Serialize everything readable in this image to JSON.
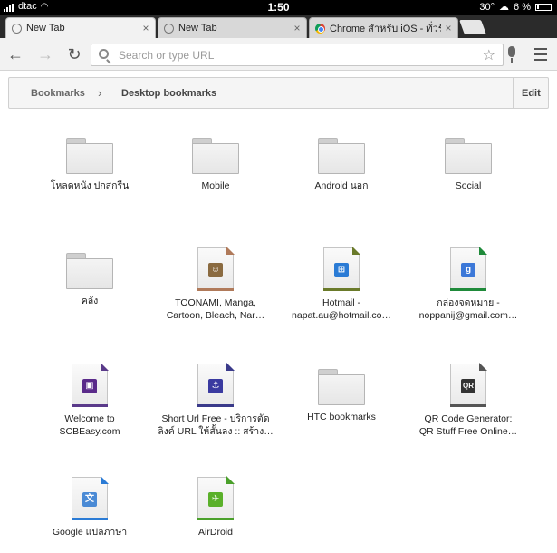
{
  "status": {
    "carrier": "dtac",
    "time": "1:50",
    "weather": "30°",
    "battery": "6 %"
  },
  "tabs": [
    {
      "title": "New Tab",
      "close": "×"
    },
    {
      "title": "New Tab",
      "close": "×"
    },
    {
      "title": "Chrome สำหรับ iOS - ทั่วร้อนแน่",
      "close": "×"
    }
  ],
  "toolbar": {
    "back": "←",
    "forward": "→",
    "reload": "↻",
    "search_placeholder": "Search or type URL",
    "star": "☆"
  },
  "breadcrumb": {
    "root": "Bookmarks",
    "separator": "›",
    "current": "Desktop bookmarks",
    "edit": "Edit"
  },
  "items": [
    {
      "kind": "folder",
      "label": "โหลดหนัง ปกสกรีน"
    },
    {
      "kind": "folder",
      "label": "Mobile"
    },
    {
      "kind": "folder",
      "label": "Android นอก"
    },
    {
      "kind": "folder",
      "label": "Social"
    },
    {
      "kind": "folder",
      "label": "คลัง"
    },
    {
      "kind": "page",
      "label": "TOONAMI, Manga,\nCartoon, Bleach, Nar…",
      "stripe": "#b07a5a",
      "favicon": "☺",
      "favcolor": "#8a6a40"
    },
    {
      "kind": "page",
      "label": "Hotmail -\nnapat.au@hotmail.co…",
      "stripe": "#6a7a2a",
      "favicon": "⊞",
      "favcolor": "#2a7bd5"
    },
    {
      "kind": "page",
      "label": "กล่องจดหมาย -\nnoppanij@gmail.com…",
      "stripe": "#1f8a3a",
      "favicon": "g",
      "favcolor": "#3c78d8"
    },
    {
      "kind": "page",
      "label": "Welcome to\nSCBEasy.com",
      "stripe": "#5a3a8a",
      "favicon": "▣",
      "favcolor": "#5a2a8a"
    },
    {
      "kind": "page",
      "label": "Short Url Free - บริการตัด\nลิงค์ URL ให้สั้นลง :: สร้าง…",
      "stripe": "#3a3a8a",
      "favicon": "⚓",
      "favcolor": "#3a3aa0"
    },
    {
      "kind": "folder",
      "label": "HTC bookmarks"
    },
    {
      "kind": "page",
      "label": "QR Code Generator:\nQR Stuff Free Online…",
      "stripe": "#555555",
      "favicon": "QR",
      "favcolor": "#333333"
    },
    {
      "kind": "page",
      "label": "Google แปลภาษา",
      "stripe": "#2a7bd5",
      "favicon": "文",
      "favcolor": "#4a8ad5"
    },
    {
      "kind": "page",
      "label": "AirDroid",
      "stripe": "#4aa02a",
      "favicon": "✈",
      "favcolor": "#5ab02a"
    }
  ]
}
